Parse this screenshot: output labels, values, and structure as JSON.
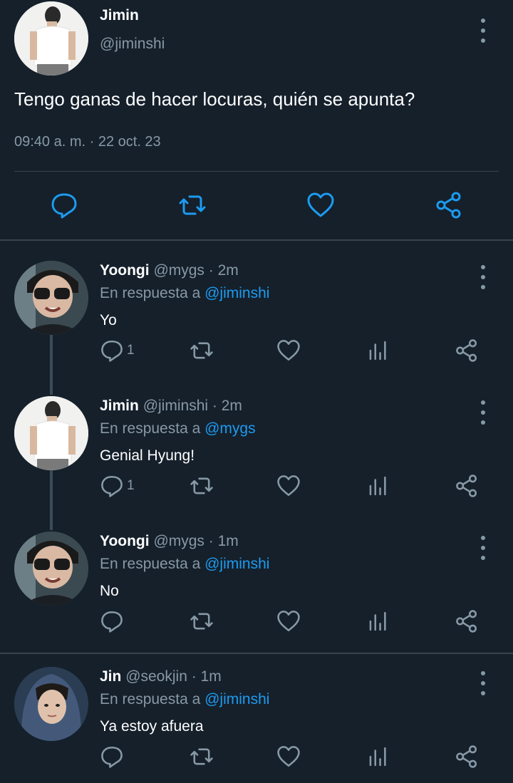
{
  "main_tweet": {
    "name": "Jimin",
    "handle": "@jiminshi",
    "text": "Tengo ganas de hacer locuras, quién se apunta?",
    "timestamp": "09:40 a. m. · 22 oct. 23",
    "actions": [
      "reply-icon",
      "retweet-icon",
      "like-icon",
      "share-icon"
    ]
  },
  "replies": [
    {
      "name": "Yoongi",
      "handle": "@mygs",
      "sep": " · ",
      "time": "2m",
      "reply_prefix": "En respuesta a ",
      "reply_to": "@jiminshi",
      "text": "Yo",
      "reply_count": "1"
    },
    {
      "name": "Jimin",
      "handle": "@jiminshi",
      "sep": " · ",
      "time": "2m",
      "reply_prefix": "En respuesta a ",
      "reply_to": "@mygs",
      "text": "Genial Hyung!",
      "reply_count": "1"
    },
    {
      "name": "Yoongi",
      "handle": "@mygs",
      "sep": " · ",
      "time": "1m",
      "reply_prefix": "En respuesta a ",
      "reply_to": "@jiminshi",
      "text": "No",
      "reply_count": ""
    },
    {
      "name": "Jin",
      "handle": "@seokjin",
      "sep": " · ",
      "time": "1m",
      "reply_prefix": "En respuesta a ",
      "reply_to": "@jiminshi",
      "text": "Ya estoy afuera",
      "reply_count": ""
    }
  ],
  "colors": {
    "background": "#15202b",
    "secondary_text": "#8899a6",
    "mention": "#1d9bf0",
    "divider": "#38444d"
  }
}
